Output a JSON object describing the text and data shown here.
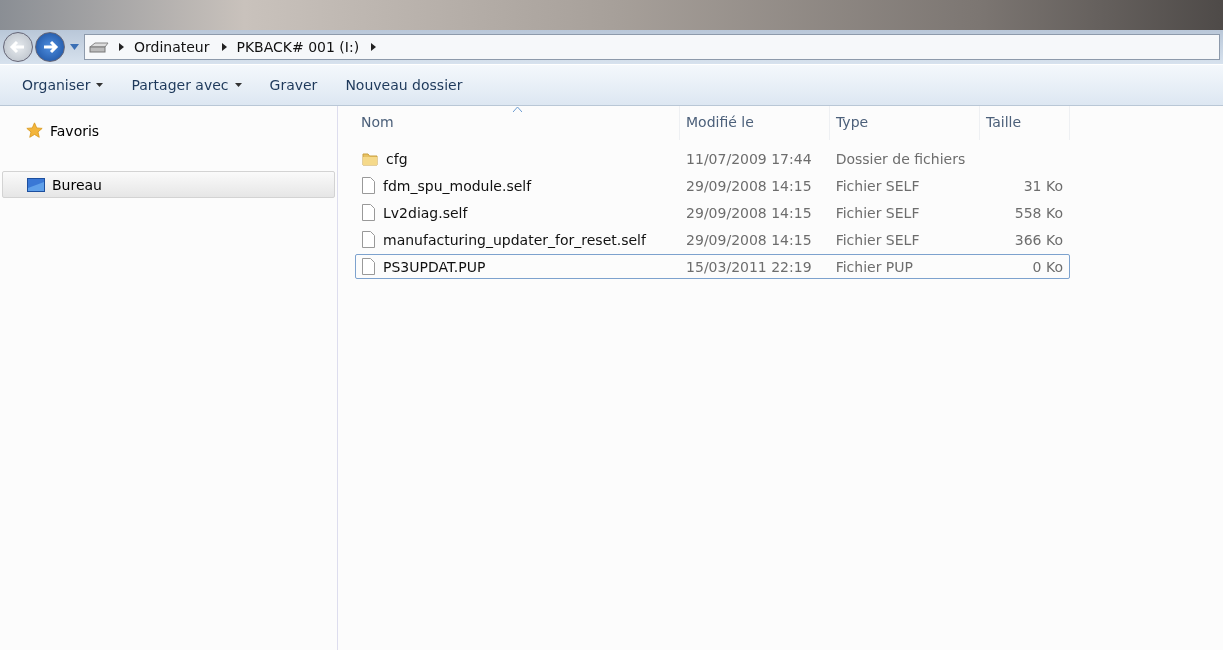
{
  "address_bar": {
    "path": [
      "Ordinateur",
      "PKBACK# 001 (I:)"
    ]
  },
  "toolbar": [
    {
      "label": "Organiser",
      "dropdown": true
    },
    {
      "label": "Partager avec",
      "dropdown": true
    },
    {
      "label": "Graver",
      "dropdown": false
    },
    {
      "label": "Nouveau dossier",
      "dropdown": false
    }
  ],
  "sidebar": {
    "items": [
      {
        "label": "Favoris",
        "kind": "star",
        "selected": false
      },
      {
        "label": "Bureau",
        "kind": "desktop",
        "selected": true
      }
    ]
  },
  "table": {
    "columns": [
      {
        "label": "Nom",
        "sorted": true
      },
      {
        "label": "Modifié le",
        "sorted": false
      },
      {
        "label": "Type",
        "sorted": false
      },
      {
        "label": "Taille",
        "sorted": false
      }
    ],
    "rows": [
      {
        "kind": "folder",
        "name": "cfg",
        "modified": "11/07/2009 17:44",
        "type": "Dossier de fichiers",
        "focused": false
      },
      {
        "kind": "file",
        "name": "fdm_spu_module.self",
        "modified": "29/09/2008 14:15",
        "type": "Fichier SELF",
        "size": "31 Ko",
        "focused": false
      },
      {
        "kind": "file",
        "name": "Lv2diag.self",
        "modified": "29/09/2008 14:15",
        "type": "Fichier SELF",
        "size": "558 Ko",
        "focused": false
      },
      {
        "kind": "file",
        "name": "manufacturing_updater_for_reset.self",
        "modified": "29/09/2008 14:15",
        "type": "Fichier SELF",
        "size": "366 Ko",
        "focused": false
      },
      {
        "kind": "file",
        "name": "PS3UPDAT.PUP",
        "modified": "15/03/2011 22:19",
        "type": "Fichier PUP",
        "size": "0 Ko",
        "focused": true
      }
    ]
  }
}
